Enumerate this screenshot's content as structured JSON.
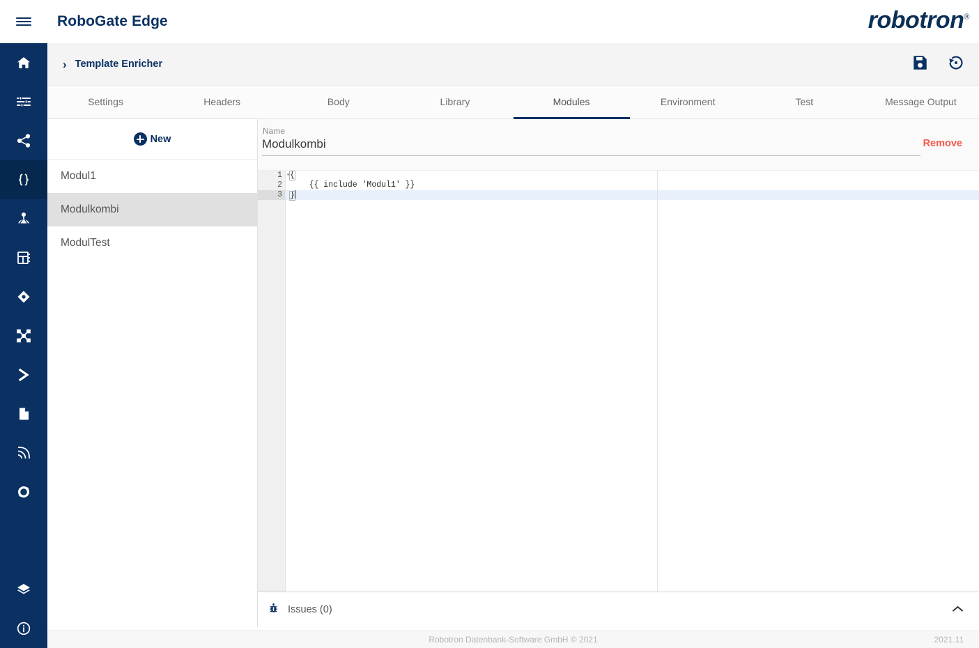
{
  "app": {
    "title": "RoboGate Edge",
    "brand": "robotron",
    "brand_mark": "®",
    "menu_icon": "hamburger-icon"
  },
  "breadcrumb": {
    "chevron": "›",
    "label": "Template Enricher"
  },
  "bar_actions": [
    {
      "name": "save-icon",
      "title": "Save"
    },
    {
      "name": "restore-icon",
      "title": "Restore"
    }
  ],
  "tabs": [
    {
      "label": "Settings",
      "active": false
    },
    {
      "label": "Headers",
      "active": false
    },
    {
      "label": "Body",
      "active": false
    },
    {
      "label": "Library",
      "active": false
    },
    {
      "label": "Modules",
      "active": true
    },
    {
      "label": "Environment",
      "active": false
    },
    {
      "label": "Test",
      "active": false
    },
    {
      "label": "Message Output",
      "active": false
    }
  ],
  "nav_items": [
    {
      "icon": "home-icon",
      "active": false
    },
    {
      "icon": "tune-icon",
      "active": false
    },
    {
      "icon": "share-icon",
      "active": false
    },
    {
      "icon": "braces-icon",
      "active": true
    },
    {
      "icon": "robot-icon",
      "active": false
    },
    {
      "icon": "dashboard-icon",
      "active": false
    },
    {
      "icon": "diamond-icon",
      "active": false
    },
    {
      "icon": "nodes-icon",
      "active": false
    },
    {
      "icon": "chevron-right-icon",
      "active": false
    },
    {
      "icon": "document-icon",
      "active": false
    },
    {
      "icon": "signal-icon",
      "active": false
    },
    {
      "icon": "circle-gear-icon",
      "active": false
    }
  ],
  "nav_bottom_items": [
    {
      "icon": "layers-icon",
      "active": false
    },
    {
      "icon": "info-icon",
      "active": false
    }
  ],
  "module_panel": {
    "new_label": "New",
    "items": [
      {
        "label": "Modul1",
        "selected": false
      },
      {
        "label": "Modulkombi",
        "selected": true
      },
      {
        "label": "ModulTest",
        "selected": false
      }
    ]
  },
  "name_field": {
    "label": "Name",
    "value": "Modulkombi",
    "placeholder": "Name"
  },
  "remove_label": "Remove",
  "editor": {
    "lines": [
      {
        "number": "1",
        "text": "{",
        "foldable": true,
        "active": false
      },
      {
        "number": "2",
        "text": "    {{ include 'Modul1' }}",
        "foldable": false,
        "active": false
      },
      {
        "number": "3",
        "text": "}",
        "foldable": false,
        "active": true
      }
    ]
  },
  "issues": {
    "icon": "bug-icon",
    "label": "Issues (0)",
    "toggle_icon": "chevron-up-icon",
    "toggle_glyph": "⌃"
  },
  "footer": {
    "copyright": "Robotron Datenbank-Software GmbH © 2021",
    "version": "2021.11"
  },
  "colors": {
    "brand_navy": "#0b3163",
    "nav_active": "#06284f",
    "remove_red": "#f4594c",
    "selected_row": "#e0e0e0",
    "active_line": "#e8f0fc"
  }
}
